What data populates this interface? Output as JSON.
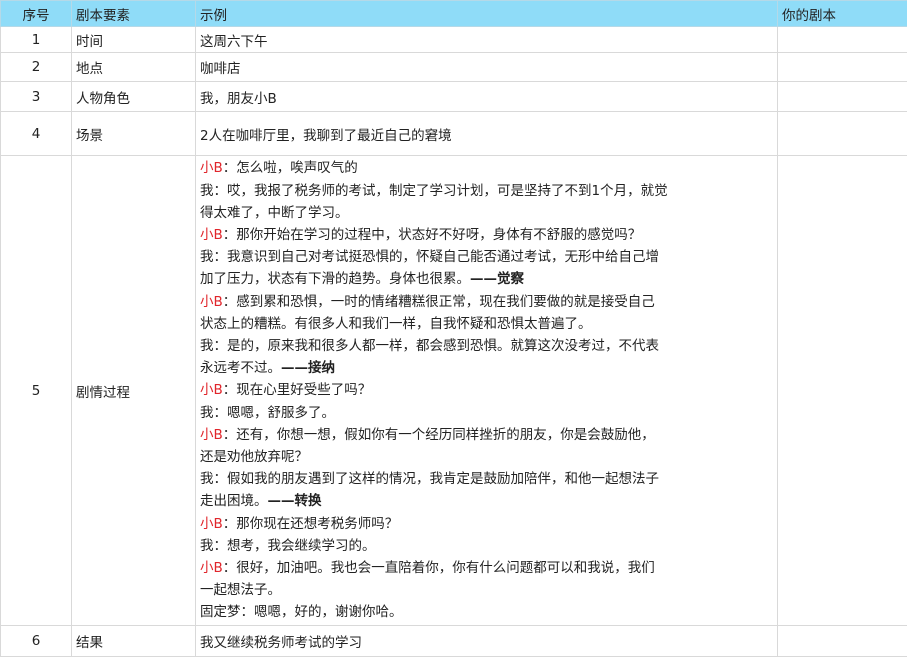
{
  "header": {
    "no": "序号",
    "element": "剧本要素",
    "example": "示例",
    "yours": "你的剧本"
  },
  "rows": [
    {
      "no": "1",
      "element": "时间",
      "example": "这周六下午"
    },
    {
      "no": "2",
      "element": "地点",
      "example": "咖啡店"
    },
    {
      "no": "3",
      "element": "人物角色",
      "example": "我，朋友小B"
    },
    {
      "no": "4",
      "element": "场景",
      "example": "2人在咖啡厅里，我聊到了最近自己的窘境"
    },
    {
      "no": "5",
      "element": "剧情过程"
    },
    {
      "no": "6",
      "element": "结果",
      "example": "我又继续税务师考试的学习"
    }
  ],
  "dialogue": [
    {
      "speaker": "小B",
      "text": "：怎么啦，唉声叹气的"
    },
    {
      "speaker": "我",
      "text": "：哎，我报了税务师的考试，制定了学习计划，可是坚持了不到1个月，就觉"
    },
    {
      "speaker": "",
      "text": "得太难了，中断了学习。"
    },
    {
      "speaker": "小B",
      "text": "：那你开始在学习的过程中，状态好不好呀，身体有不舒服的感觉吗？"
    },
    {
      "speaker": "我",
      "text": "：我意识到自己对考试挺恐惧的，怀疑自己能否通过考试，无形中给自己增"
    },
    {
      "speaker": "",
      "text": "加了压力，状态有下滑的趋势。身体也很累。",
      "tag": "——觉察"
    },
    {
      "speaker": "小B",
      "text": "：感到累和恐惧，一时的情绪糟糕很正常，现在我们要做的就是接受自己"
    },
    {
      "speaker": "",
      "text": "状态上的糟糕。有很多人和我们一样，自我怀疑和恐惧太普遍了。"
    },
    {
      "speaker": "我",
      "text": "：是的，原来我和很多人都一样，都会感到恐惧。就算这次没考过，不代表"
    },
    {
      "speaker": "",
      "text": "永远考不过。",
      "tag": "——接纳"
    },
    {
      "speaker": "小B",
      "text": "：现在心里好受些了吗？"
    },
    {
      "speaker": "我",
      "text": "：嗯嗯，舒服多了。"
    },
    {
      "speaker": "小B",
      "text": "：还有，你想一想，假如你有一个经历同样挫折的朋友，你是会鼓励他，"
    },
    {
      "speaker": "",
      "text": "还是劝他放弃呢？"
    },
    {
      "speaker": "我",
      "text": "：假如我的朋友遇到了这样的情况，我肯定是鼓励加陪伴，和他一起想法子"
    },
    {
      "speaker": "",
      "text": "走出困境。",
      "tag": "——转换"
    },
    {
      "speaker": "小B",
      "text": "：那你现在还想考税务师吗？"
    },
    {
      "speaker": "我",
      "text": "：想考，我会继续学习的。"
    },
    {
      "speaker": "小B",
      "text": "：很好，加油吧。我也会一直陪着你，你有什么问题都可以和我说，我们"
    },
    {
      "speaker": "",
      "text": "一起想法子。"
    },
    {
      "speaker": "固定梦",
      "text": "：嗯嗯，好的，谢谢你哈。"
    }
  ],
  "colors": {
    "header_bg": "#8fdcf8",
    "speaker_b": "#e0252b",
    "grid": "#d9d9d9"
  }
}
